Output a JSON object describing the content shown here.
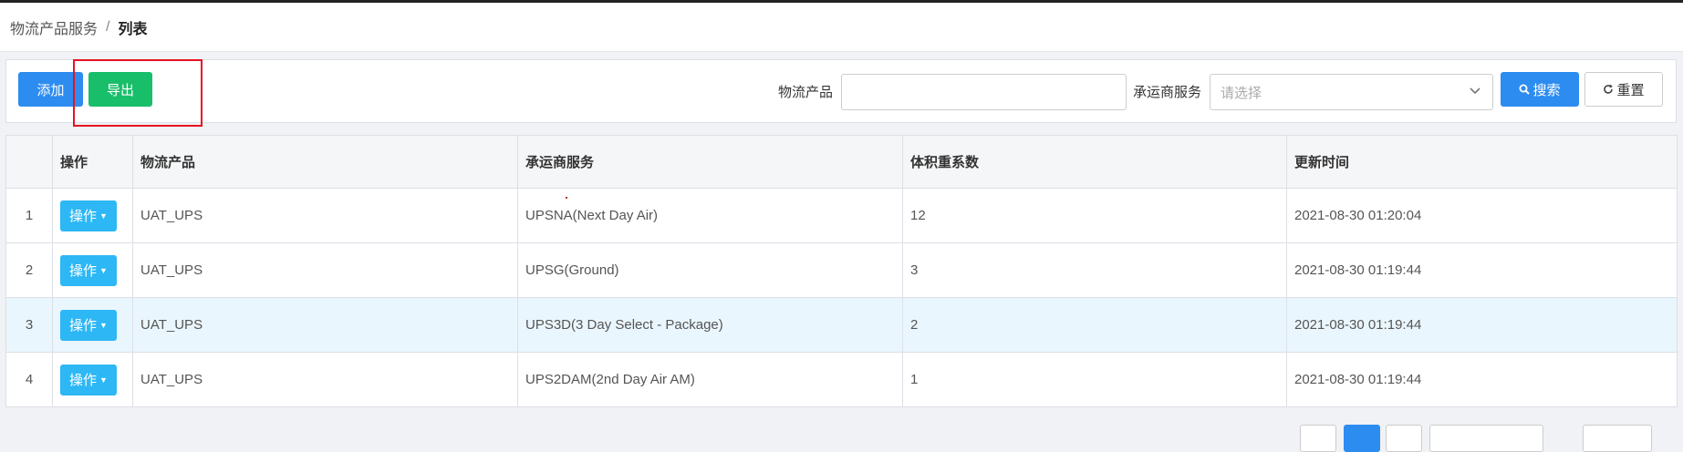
{
  "breadcrumb": {
    "parent": "物流产品服务",
    "separator": "/",
    "current": "列表"
  },
  "toolbar": {
    "add_label": "添加",
    "export_label": "导出",
    "product_label": "物流产品",
    "product_value": "",
    "service_label": "承运商服务",
    "service_placeholder": "请选择",
    "search_label": "搜索",
    "reset_label": "重置"
  },
  "table": {
    "headers": [
      "",
      "操作",
      "物流产品",
      "承运商服务",
      "体积重系数",
      "更新时间"
    ],
    "op_label": "操作",
    "rows": [
      {
        "index": "1",
        "product": "UAT_UPS",
        "service": "UPSNA(Next Day Air)",
        "coefficient": "12",
        "updated": "2021-08-30 01:20:04"
      },
      {
        "index": "2",
        "product": "UAT_UPS",
        "service": "UPSG(Ground)",
        "coefficient": "3",
        "updated": "2021-08-30 01:19:44"
      },
      {
        "index": "3",
        "product": "UAT_UPS",
        "service": "UPS3D(3 Day Select - Package)",
        "coefficient": "2",
        "updated": "2021-08-30 01:19:44"
      },
      {
        "index": "4",
        "product": "UAT_UPS",
        "service": "UPS2DAM(2nd Day Air AM)",
        "coefficient": "1",
        "updated": "2021-08-30 01:19:44"
      }
    ]
  },
  "colors": {
    "primary": "#2d8cf0",
    "success": "#19be6b",
    "info": "#2db7f5",
    "highlight": "#e81123"
  },
  "icons": {
    "search": "search-icon",
    "reset": "refresh-icon",
    "select": "chevron-down-icon",
    "dropdown": "caret-down-icon"
  }
}
